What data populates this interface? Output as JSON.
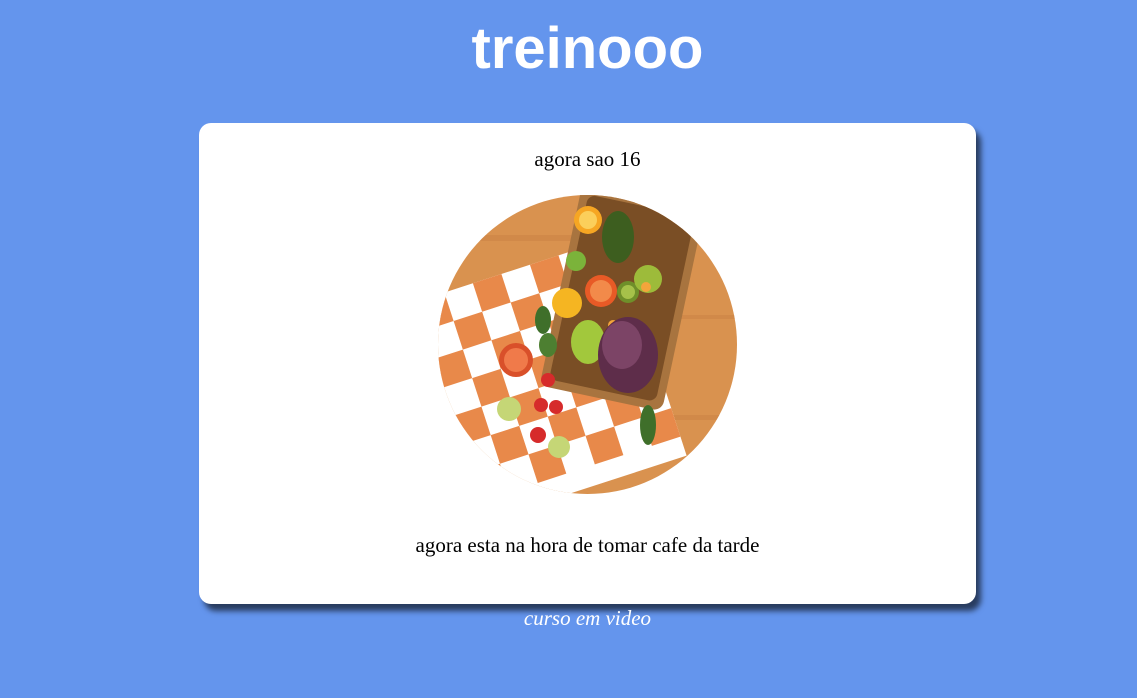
{
  "header": {
    "title": "treinooo"
  },
  "card": {
    "time_text": "agora sao 16",
    "message_text": "agora esta na hora de tomar cafe da tarde",
    "image": {
      "subject": "picnic basket with fresh fruits on a checkered cloth"
    }
  },
  "footer": {
    "text": "curso em video"
  },
  "colors": {
    "background": "#6495ED",
    "card": "#FFFFFF",
    "title_text": "#FFFFFF"
  }
}
